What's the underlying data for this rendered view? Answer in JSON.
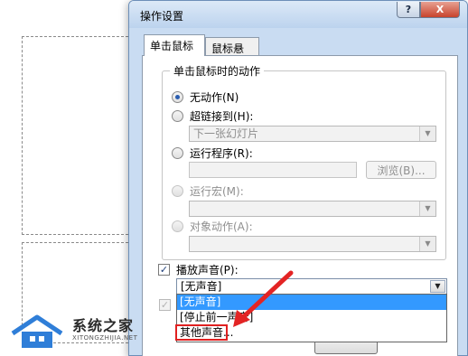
{
  "dialog": {
    "title": "操作设置",
    "help_label": "?",
    "close_label": "X"
  },
  "tabs": [
    {
      "label": "单击鼠标",
      "active": true
    },
    {
      "label": "鼠标悬停",
      "active": false
    }
  ],
  "group": {
    "title": "单击鼠标时的动作",
    "options": {
      "none": {
        "label": "无动作(N)",
        "checked": true,
        "enabled": true
      },
      "hyperlink": {
        "label": "超链接到(H):",
        "checked": false,
        "enabled": true,
        "value": "下一张幻灯片"
      },
      "run_program": {
        "label": "运行程序(R):",
        "checked": false,
        "enabled": true,
        "browse_label": "浏览(B)..."
      },
      "run_macro": {
        "label": "运行宏(M):",
        "checked": false,
        "enabled": false
      },
      "object_action": {
        "label": "对象动作(A):",
        "checked": false,
        "enabled": false
      }
    }
  },
  "sound": {
    "label": "播放声音(P):",
    "checked": true,
    "value": "[无声音]",
    "dropdown_items": [
      "[无声音]",
      "[停止前一声音]",
      "其他声音..."
    ],
    "selected_index": 0
  },
  "icons": {
    "dropdown": "chevron-down-icon",
    "checkmark": "check-icon"
  },
  "watermark": {
    "title": "系统之家",
    "subtitle": "XITONGZHIJIA.NET"
  }
}
